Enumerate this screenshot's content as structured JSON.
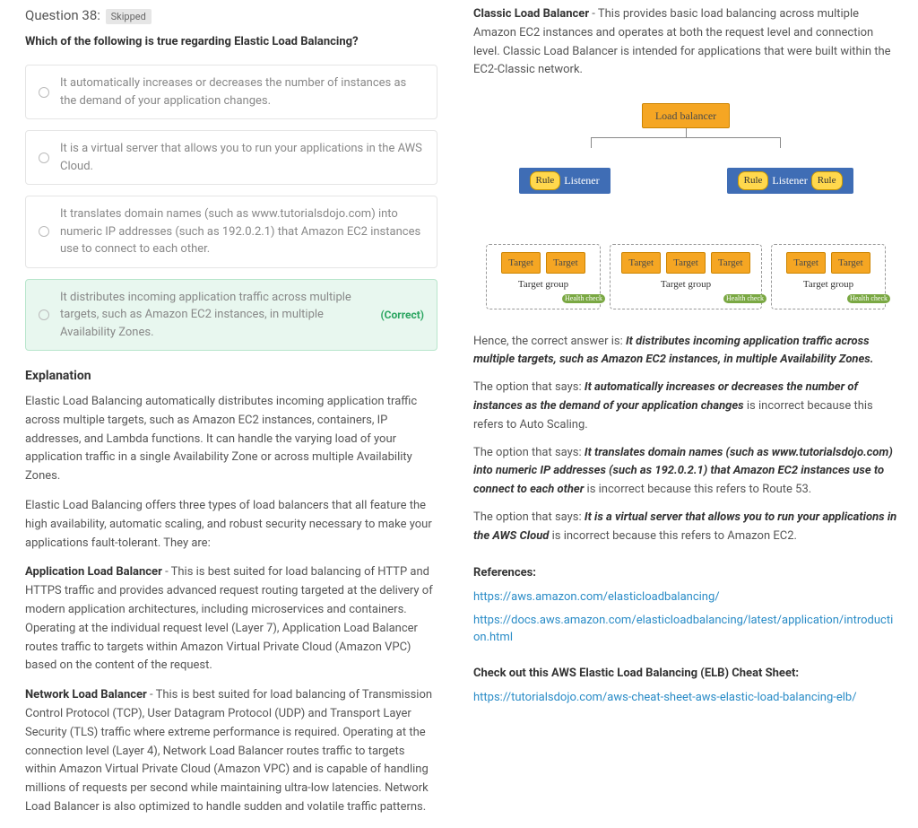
{
  "question": {
    "number_label": "Question 38:",
    "status": "Skipped",
    "text": "Which of the following is true regarding Elastic Load Balancing?"
  },
  "choices": [
    "It automatically increases or decreases the number of instances as the demand of your application changes.",
    "It is a virtual server that allows you to run your applications in the AWS Cloud.",
    "It translates domain names (such as www.tutorialsdojo.com) into numeric IP addresses (such as 192.0.2.1) that Amazon EC2 instances use to connect to each other.",
    "It distributes incoming application traffic across multiple targets, such as Amazon EC2 instances, in multiple Availability Zones."
  ],
  "correct_tag": "(Correct)",
  "explanation": {
    "heading": "Explanation",
    "p1": "Elastic Load Balancing automatically distributes incoming application traffic across multiple targets, such as Amazon EC2 instances, containers, IP addresses, and Lambda functions. It can handle the varying load of your application traffic in a single Availability Zone or across multiple Availability Zones.",
    "p2": "Elastic Load Balancing offers three types of load balancers that all feature the high availability, automatic scaling, and robust security necessary to make your applications fault-tolerant. They are:",
    "alb_label": "Application Load Balancer",
    "alb_text": " - This is best suited for load balancing of HTTP and HTTPS traffic and provides advanced request routing targeted at the delivery of modern application architectures, including microservices and containers. Operating at the individual request level (Layer 7), Application Load Balancer routes traffic to targets within Amazon Virtual Private Cloud (Amazon VPC) based on the content of the request.",
    "nlb_label": "Network Load Balancer",
    "nlb_text": " - This is best suited for load balancing of Transmission Control Protocol (TCP), User Datagram Protocol (UDP) and Transport Layer Security (TLS) traffic where extreme performance is required. Operating at the connection level (Layer 4), Network Load Balancer routes traffic to targets within Amazon Virtual Private Cloud (Amazon VPC) and is capable of handling millions of requests per second while maintaining ultra-low latencies. Network Load Balancer is also optimized to handle sudden and volatile traffic patterns.",
    "clb_label": "Classic Load Balancer",
    "clb_text": " - This provides basic load balancing across multiple Amazon EC2 instances and operates at both the request level and connection level. Classic Load Balancer is intended for applications that were built within the EC2-Classic network."
  },
  "diagram": {
    "load_balancer": "Load balancer",
    "rule": "Rule",
    "listener": "Listener",
    "target": "Target",
    "target_group": "Target group",
    "health_check": "Health\ncheck"
  },
  "analysis": {
    "hence_prefix": "Hence, the correct answer is: ",
    "hence_ans": "It distributes incoming application traffic across multiple targets, such as Amazon EC2 instances, in multiple Availability Zones.",
    "opt1_prefix": "The option that says: ",
    "opt1_quote": "It automatically increases or decreases the number of instances as the demand of your application changes",
    "opt1_tail": " is incorrect because this refers to Auto Scaling.",
    "opt2_quote": "It translates domain names (such as www.tutorialsdojo.com) into numeric IP addresses (such as 192.0.2.1) that Amazon EC2 instances use to connect to each other",
    "opt2_tail": " is incorrect because this refers to Route 53.",
    "opt3_quote": "It is a virtual server that allows you to run your applications in the AWS Cloud",
    "opt3_tail": " is incorrect because this refers to Amazon EC2."
  },
  "references": {
    "heading": "References:",
    "link1": "https://aws.amazon.com/elasticloadbalancing/",
    "link2": "https://docs.aws.amazon.com/elasticloadbalancing/latest/application/introduction.html"
  },
  "cheatsheet": {
    "heading": "Check out this AWS Elastic Load Balancing (ELB) Cheat Sheet:",
    "link": "https://tutorialsdojo.com/aws-cheat-sheet-aws-elastic-load-balancing-elb/"
  }
}
